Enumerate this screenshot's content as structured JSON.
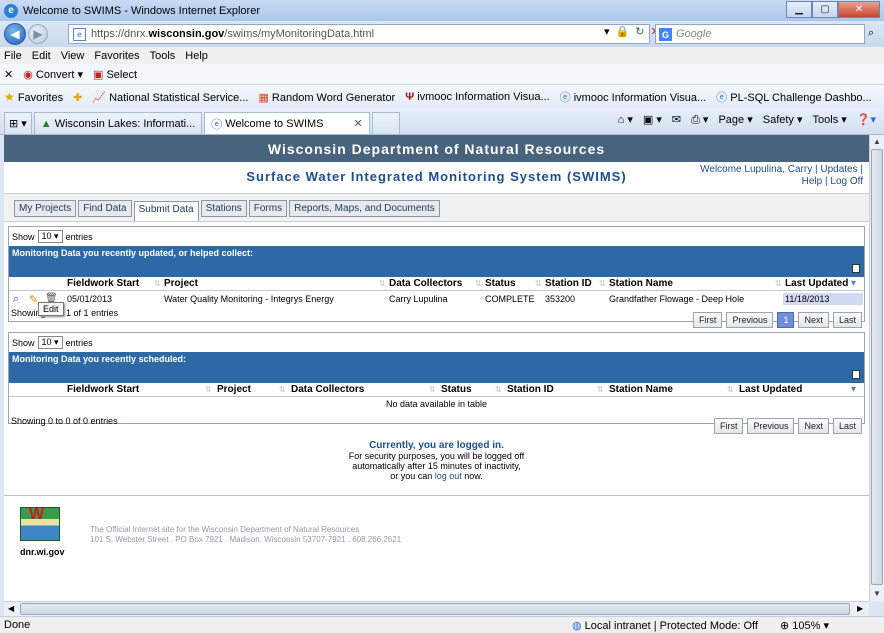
{
  "window": {
    "title": "Welcome to SWIMS - Windows Internet Explorer"
  },
  "address": {
    "url_prefix": "https://dnrx.",
    "url_domain": "wisconsin.gov",
    "url_path": "/swims/myMonitoringData.html",
    "search_placeholder": "Google"
  },
  "menu": [
    "File",
    "Edit",
    "View",
    "Favorites",
    "Tools",
    "Help"
  ],
  "command_bar": [
    "Convert ▾",
    "Select"
  ],
  "favorites": {
    "label": "Favorites",
    "items": [
      "National Statistical Service...",
      "Random Word Generator",
      "ivmooc Information Visua...",
      "ivmooc Information Visua...",
      "PL-SQL Challenge Dashbo..."
    ]
  },
  "tabs": [
    {
      "label": "Wisconsin Lakes: Informati..."
    },
    {
      "label": "Welcome to SWIMS"
    }
  ],
  "tab_tools": [
    "Page ▾",
    "Safety ▾",
    "Tools ▾"
  ],
  "page": {
    "banner": "Wisconsin Department of Natural Resources",
    "swims_title": "Surface Water Integrated Monitoring System (SWIMS)",
    "welcome_line1": "Welcome Lupulina, Carry | Updates |",
    "welcome_line2": "Help | Log Off",
    "app_tabs": [
      "My Projects",
      "Find Data",
      "Submit Data",
      "Stations",
      "Forms",
      "Reports, Maps, and Documents"
    ]
  },
  "table1": {
    "show_label": "Show",
    "show_value": "10",
    "entries_label": "entries",
    "caption": "Monitoring Data you recently updated, or helped collect:",
    "headers": [
      "Fieldwork Start",
      "Project",
      "Data Collectors",
      "Status",
      "Station ID",
      "Station Name",
      "Last Updated"
    ],
    "rows": [
      {
        "fieldwork_start": "05/01/2013",
        "project": "Water Quality Monitoring - Integrys Energy",
        "data_collectors": "Carry Lupulina",
        "status": "COMPLETE",
        "station_id": "353200",
        "station_name": "Grandfather Flowage - Deep Hole",
        "last_updated": "11/18/2013"
      }
    ],
    "info_prefix": "Showing",
    "info_suffix": "1 of 1 entries",
    "tooltip": "Edit",
    "pager": [
      "First",
      "Previous",
      "1",
      "Next",
      "Last"
    ]
  },
  "table2": {
    "show_label": "Show",
    "show_value": "10",
    "entries_label": "entries",
    "caption": "Monitoring Data you recently scheduled:",
    "headers": [
      "Fieldwork Start",
      "Project",
      "Data Collectors",
      "Status",
      "Station ID",
      "Station Name",
      "Last Updated"
    ],
    "empty": "No data available in table",
    "info": "Showing 0 to 0 of 0 entries",
    "pager": [
      "First",
      "Previous",
      "Next",
      "Last"
    ]
  },
  "login": {
    "heading": "Currently, you are logged in.",
    "line1": "For security purposes, you will be logged off",
    "line2": "automatically after 15 minutes of inactivity,",
    "line3_prefix": "or you can",
    "logout_link": "log out",
    "line3_suffix": "now."
  },
  "footer": {
    "logo_letter": "W",
    "site": "dnr.wi.gov",
    "official_line1": "The Official Internet site for the Wisconsin Department of Natural Resources",
    "official_line2": "101 S. Webster Street . PO Box 7921 . Madison, Wisconsin 53707-7921 . 608.266.2621"
  },
  "statusbar": {
    "left": "Done",
    "zone": "Local intranet | Protected Mode: Off",
    "zoom": "105%"
  },
  "colors": {
    "banner": "#47637d",
    "caption": "#2d6aa5",
    "link": "#1c4f93"
  }
}
